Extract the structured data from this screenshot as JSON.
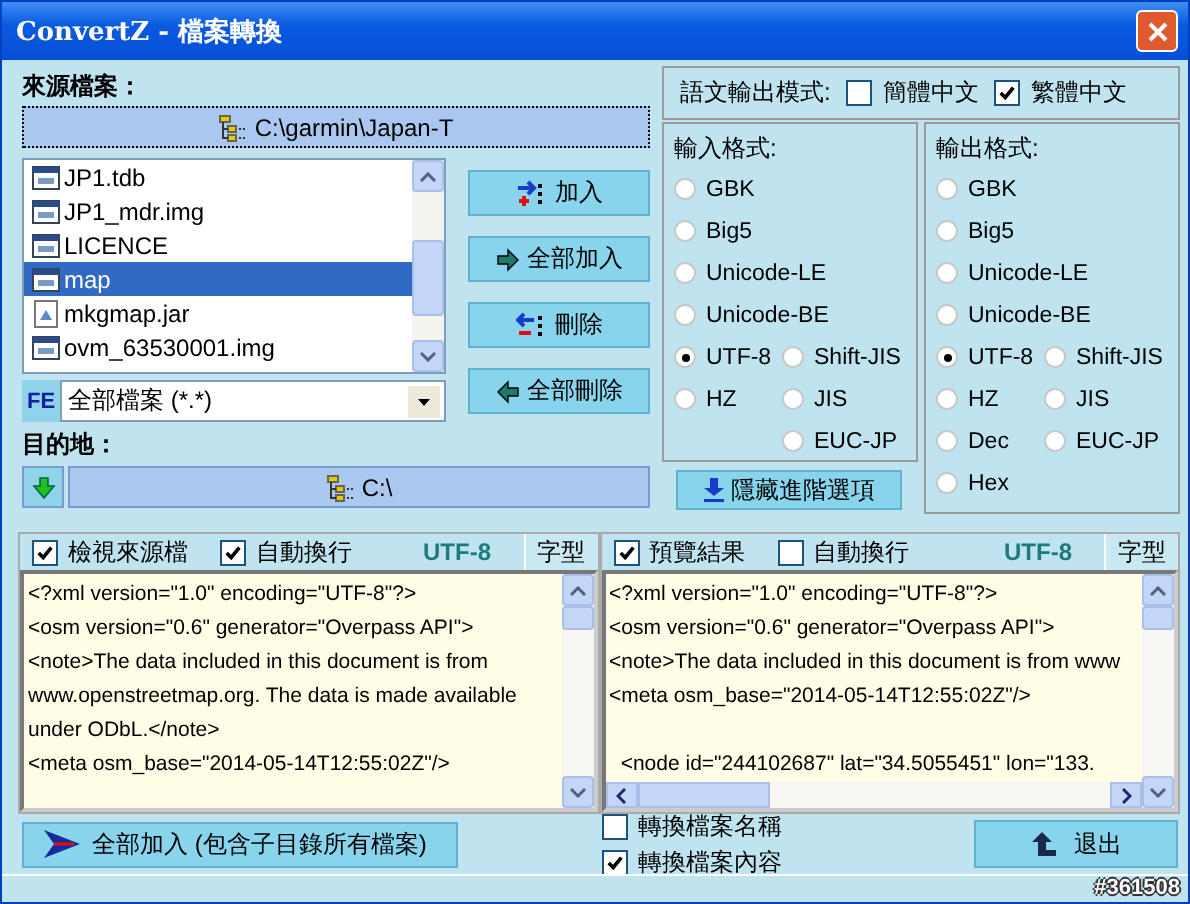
{
  "window": {
    "title": "ConvertZ - 檔案轉換"
  },
  "source": {
    "label": "來源檔案：",
    "path": "C:\\garmin\\Japan-T",
    "files": [
      {
        "name": "JP1.tdb",
        "kind": "file",
        "selected": false
      },
      {
        "name": "JP1_mdr.img",
        "kind": "file",
        "selected": false
      },
      {
        "name": "LICENCE",
        "kind": "file",
        "selected": false
      },
      {
        "name": "map",
        "kind": "file",
        "selected": true
      },
      {
        "name": "mkgmap.jar",
        "kind": "jar",
        "selected": false
      },
      {
        "name": "ovm_63530001.img",
        "kind": "file",
        "selected": false
      }
    ],
    "filter": {
      "badge": "FE",
      "value": "全部檔案 (*.*)"
    }
  },
  "list_buttons": [
    {
      "label": "加入",
      "kind": "add"
    },
    {
      "label": "全部加入",
      "kind": "add_all"
    },
    {
      "label": "刪除",
      "kind": "remove"
    },
    {
      "label": "全部刪除",
      "kind": "remove_all"
    }
  ],
  "destination": {
    "label": "目的地：",
    "path": "C:\\"
  },
  "language_mode": {
    "label": "語文輸出模式:",
    "options": [
      {
        "label": "簡體中文",
        "checked": false
      },
      {
        "label": "繁體中文",
        "checked": true
      }
    ]
  },
  "formats": [
    {
      "label": "輸入格式:",
      "options": [
        {
          "label": "GBK",
          "selected": false
        },
        {
          "label": "Big5",
          "selected": false
        },
        {
          "label": "Unicode-LE",
          "selected": false
        },
        {
          "label": "Unicode-BE",
          "selected": false
        },
        {
          "label": "UTF-8",
          "selected": true
        },
        {
          "label": "Shift-JIS",
          "selected": false
        },
        {
          "label": "HZ",
          "selected": false
        },
        {
          "label": "JIS",
          "selected": false
        },
        {
          "label": "EUC-JP",
          "selected": false
        }
      ]
    },
    {
      "label": "輸出格式:",
      "options": [
        {
          "label": "GBK",
          "selected": false
        },
        {
          "label": "Big5",
          "selected": false
        },
        {
          "label": "Unicode-LE",
          "selected": false
        },
        {
          "label": "Unicode-BE",
          "selected": false
        },
        {
          "label": "UTF-8",
          "selected": true
        },
        {
          "label": "Shift-JIS",
          "selected": false
        },
        {
          "label": "HZ",
          "selected": false
        },
        {
          "label": "JIS",
          "selected": false
        },
        {
          "label": "Dec",
          "selected": false
        },
        {
          "label": "EUC-JP",
          "selected": false
        },
        {
          "label": "Hex",
          "selected": false
        }
      ]
    }
  ],
  "hide_advanced_button": "隱藏進階選項",
  "panels": [
    {
      "checkboxes": [
        {
          "label": "檢視來源檔",
          "checked": true
        },
        {
          "label": "自動換行",
          "checked": true
        }
      ],
      "encoding": "UTF-8",
      "font_button": "字型",
      "horizontal_scroll": false,
      "lines": [
        {
          "text": "<?xml version=\"1.0\" encoding=\"UTF-8\"?>",
          "blank_before": false
        },
        {
          "text": "<osm version=\"0.6\" generator=\"Overpass API\">",
          "blank_before": false
        },
        {
          "text": "<note>The data included in this document is from",
          "blank_before": false
        },
        {
          "text": "www.openstreetmap.org. The data is made available",
          "blank_before": false
        },
        {
          "text": "under ODbL.</note>",
          "blank_before": false
        },
        {
          "text": "<meta osm_base=\"2014-05-14T12:55:02Z\"/>",
          "blank_before": false
        }
      ]
    },
    {
      "checkboxes": [
        {
          "label": "預覽結果",
          "checked": true
        },
        {
          "label": "自動換行",
          "checked": false
        }
      ],
      "encoding": "UTF-8",
      "font_button": "字型",
      "horizontal_scroll": true,
      "lines": [
        {
          "text": "<?xml version=\"1.0\" encoding=\"UTF-8\"?>",
          "blank_before": false
        },
        {
          "text": "<osm version=\"0.6\" generator=\"Overpass API\">",
          "blank_before": false
        },
        {
          "text": "<note>The data included in this document is from www",
          "blank_before": false
        },
        {
          "text": "<meta osm_base=\"2014-05-14T12:55:02Z\"/>",
          "blank_before": false
        },
        {
          "text": "  <node id=\"244102687\" lat=\"34.5055451\" lon=\"133.",
          "blank_before": true
        }
      ]
    }
  ],
  "add_all_subfolders_button": "全部加入 (包含子目錄所有檔案)",
  "convert_options": [
    {
      "label": "轉換檔案名稱",
      "checked": false
    },
    {
      "label": "轉換檔案內容",
      "checked": true
    }
  ],
  "exit_button": "退出",
  "status_bar": "#361508"
}
